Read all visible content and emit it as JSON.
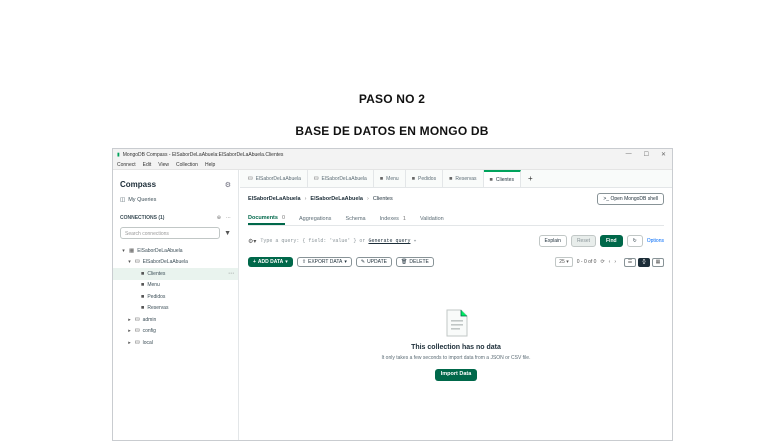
{
  "slide": {
    "title_1": "PASO NO 2",
    "title_2": "BASE DE DATOS EN MONGO DB"
  },
  "window": {
    "title": "MongoDB Compass - ElSaborDeLaAbuela:ElSaborDeLaAbuela.Clientes",
    "controls": [
      "—",
      "☐",
      "✕"
    ],
    "menu": [
      "Connect",
      "Edit",
      "View",
      "Collection",
      "Help"
    ]
  },
  "sidebar": {
    "title": "Compass",
    "my_queries": "My Queries",
    "connections_label": "CONNECTIONS (1)",
    "search_placeholder": "Search connections",
    "tree": [
      {
        "label": "ElSaborDeLaAbuela",
        "level": 0,
        "icon": "server",
        "expanded": true
      },
      {
        "label": "ElSaborDeLaAbuela",
        "level": 1,
        "icon": "database",
        "expanded": true
      },
      {
        "label": "Clientes",
        "level": 2,
        "icon": "folder",
        "selected": true
      },
      {
        "label": "Menu",
        "level": 2,
        "icon": "folder"
      },
      {
        "label": "Pedidos",
        "level": 2,
        "icon": "folder"
      },
      {
        "label": "Reservas",
        "level": 2,
        "icon": "folder"
      },
      {
        "label": "admin",
        "level": 1,
        "icon": "database"
      },
      {
        "label": "config",
        "level": 1,
        "icon": "database"
      },
      {
        "label": "local",
        "level": 1,
        "icon": "database"
      }
    ]
  },
  "tabs": [
    {
      "label": "ElSaborDeLaAbuela",
      "icon": "db"
    },
    {
      "label": "ElSaborDeLaAbuela",
      "icon": "db"
    },
    {
      "label": "Menu",
      "icon": "folder"
    },
    {
      "label": "Pedidos",
      "icon": "folder"
    },
    {
      "label": "Reservas",
      "icon": "folder"
    },
    {
      "label": "Clientes",
      "icon": "folder",
      "active": true
    }
  ],
  "breadcrumb": {
    "connection": "ElSaborDeLaAbuela",
    "database": "ElSaborDeLaAbuela",
    "collection": "Clientes"
  },
  "open_shell_label": "Open MongoDB shell",
  "subtabs": [
    {
      "label": "Documents",
      "count": "0",
      "active": true
    },
    {
      "label": "Aggregations"
    },
    {
      "label": "Schema"
    },
    {
      "label": "Indexes",
      "count": "1"
    },
    {
      "label": "Validation"
    }
  ],
  "query": {
    "placeholder_prefix": "Type a query: { field: 'value' } or",
    "generate_link": "Generate query",
    "explain": "Explain",
    "reset": "Reset",
    "find": "Find",
    "options": "Options"
  },
  "actions": {
    "add_data": "ADD DATA",
    "export_data": "EXPORT DATA",
    "update": "UPDATE",
    "delete": "DELETE",
    "page_size": "25",
    "range": "0 - 0 of 0"
  },
  "empty_state": {
    "title": "This collection has no data",
    "description": "It only takes a few seconds to import data from a JSON or CSV file.",
    "import_button": "Import Data"
  },
  "colors": {
    "accent_green": "#00684a",
    "brand_green": "#00a35c",
    "text_dark": "#1c2d38"
  }
}
